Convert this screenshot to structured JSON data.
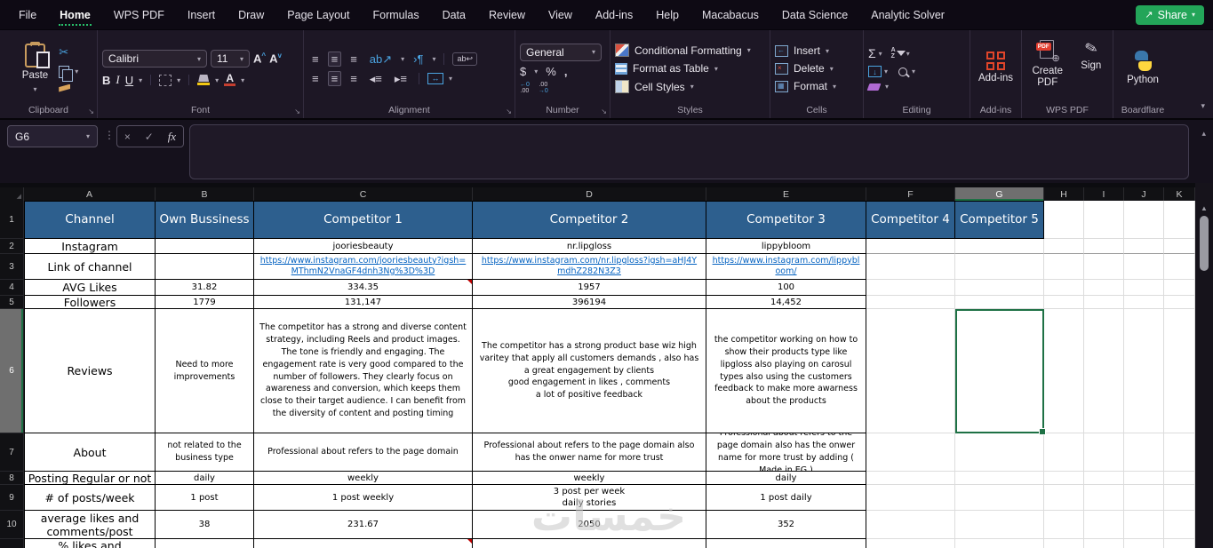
{
  "menubar": {
    "tabs": [
      "File",
      "Home",
      "WPS PDF",
      "Insert",
      "Draw",
      "Page Layout",
      "Formulas",
      "Data",
      "Review",
      "View",
      "Add-ins",
      "Help",
      "Macabacus",
      "Data Science",
      "Analytic Solver"
    ],
    "active_tab": "Home",
    "share_label": "Share"
  },
  "ribbon": {
    "paste_label": "Paste",
    "font_name": "Calibri",
    "font_size": "11",
    "bold": "B",
    "italic": "I",
    "underline": "U",
    "increase_font": "A",
    "decrease_font": "A",
    "font_color_letter": "A",
    "number_format": "General",
    "currency": "$",
    "percent": "%",
    "comma": ",",
    "styles": {
      "conditional_formatting": "Conditional Formatting",
      "format_as_table": "Format as Table",
      "cell_styles": "Cell Styles"
    },
    "cells": {
      "insert": "Insert",
      "delete": "Delete",
      "format": "Format"
    },
    "addins_label": "Add-ins",
    "create_pdf_label": "Create PDF",
    "sign_label": "Sign",
    "python_label": "Python",
    "group_labels": [
      "Clipboard",
      "Font",
      "Alignment",
      "Number",
      "Styles",
      "Cells",
      "Editing",
      "Add-ins",
      "WPS PDF",
      "Boardflare"
    ]
  },
  "formula_bar": {
    "name_box": "G6",
    "fx_label": "fx"
  },
  "sheet": {
    "columns": [
      "A",
      "B",
      "C",
      "D",
      "E",
      "F",
      "G",
      "H",
      "I",
      "J",
      "K"
    ],
    "rows_nums": [
      "1",
      "2",
      "3",
      "4",
      "5",
      "6",
      "7",
      "8",
      "9",
      "10"
    ],
    "selected_column": "G",
    "selected_row": "6",
    "header_fill": "#2d5f8e",
    "selection_color": "#1e7145",
    "link_color": "#0563c1",
    "header": [
      "Channel",
      "Own Bussiness",
      "Competitor 1",
      "Competitor 2",
      "Competitor 3",
      "Competitor 4",
      "Competitor 5"
    ],
    "rows": [
      [
        "Instagram",
        "",
        "jooriesbeauty",
        "nr.lipgloss",
        "lippybloom"
      ],
      [
        "Link of channel",
        "",
        "https://www.instagram.com/jooriesbeauty?igsh=MThmN2VnaGF4dnh3Ng%3D%3D",
        "https://www.instagram.com/nr.lipgloss?igsh=aHJ4YmdhZ282N3Z3",
        "https://www.instagram.com/lippybloom/"
      ],
      [
        "AVG Likes",
        "31.82",
        "334.35",
        "1957",
        "100"
      ],
      [
        "Followers",
        "1779",
        "131,147",
        "396194",
        "14,452"
      ],
      [
        "Reviews",
        "Need to more improvements",
        "The competitor has a strong and diverse content strategy, including Reels and product images. The tone is friendly and engaging. The engagement rate is very good compared to the number of followers. They clearly focus on awareness and conversion, which keeps them close to their target audience. I can benefit from the diversity of content and posting timing",
        "The competitor has a strong product base wiz high varitey that apply all customers demands , also has a great engagement by clients\ngood engagement in likes , comments\na lot of positive feedback",
        "the competitor working on how to show their products type like lipgloss also playing on carosul types also using the customers feedback to make more awarness about the products"
      ],
      [
        "About",
        "not related to the business type",
        "Professional about refers to the page domain",
        "Professional about refers to the page domain also has the onwer name for more trust",
        "Professional about refers to the page domain also has the onwer name for more trust by adding ( Made in EG )"
      ],
      [
        "Posting Regular or not",
        "daily",
        "weekly",
        "weekly",
        "daily"
      ],
      [
        "# of posts/week",
        "1 post",
        "1 post weekly",
        "3 post per week\ndaily stories",
        "1 post daily"
      ],
      [
        "average likes and comments/post",
        "38",
        "231.67",
        "2050",
        "352"
      ],
      [
        "% likes and",
        "",
        "",
        "",
        ""
      ]
    ],
    "watermark": "خمسات"
  },
  "icons": {
    "chevron_down": "▾",
    "chevron_up": "▴",
    "dots": "⋮",
    "cancel": "×",
    "confirm": "✓",
    "cut": "✂",
    "sum": "Σ",
    "paragraph": "›¶",
    "orientation": "ab↗",
    "share_arrow": "↗",
    "launcher": "↘",
    "align_lines": "≡",
    "arrow_down": "↓",
    "merge_arrows": "↔",
    "wrap_text": "ab↩",
    "indent_left": "◂≡",
    "indent_right": "▸≡",
    "sort_a": "A",
    "sort_z": "Z",
    "pen": "✎",
    "plus_circle": "⊕",
    "pdf_badge": "PDF",
    "scroll_up": "▲",
    "corner": "◢"
  }
}
